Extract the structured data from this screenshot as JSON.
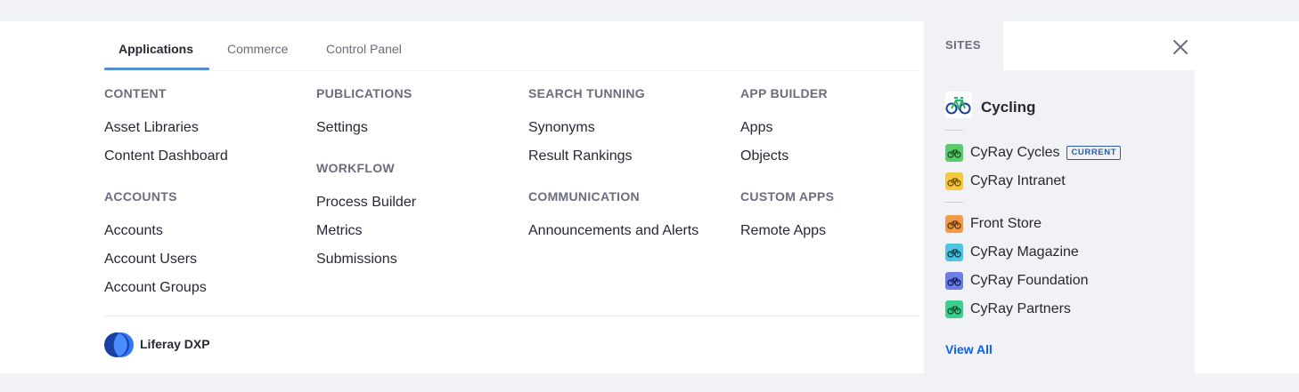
{
  "tabs": [
    {
      "label": "Applications",
      "active": true
    },
    {
      "label": "Commerce",
      "active": false
    },
    {
      "label": "Control Panel",
      "active": false
    }
  ],
  "columns": [
    {
      "sections": [
        {
          "title": "CONTENT",
          "items": [
            "Asset Libraries",
            "Content Dashboard"
          ]
        },
        {
          "title": "ACCOUNTS",
          "items": [
            "Accounts",
            "Account Users",
            "Account Groups"
          ]
        }
      ]
    },
    {
      "sections": [
        {
          "title": "PUBLICATIONS",
          "items": [
            "Settings"
          ]
        },
        {
          "title": "WORKFLOW",
          "items": [
            "Process Builder",
            "Metrics",
            "Submissions"
          ]
        }
      ]
    },
    {
      "sections": [
        {
          "title": "SEARCH TUNNING",
          "items": [
            "Synonyms",
            "Result Rankings"
          ]
        },
        {
          "title": "COMMUNICATION",
          "items": [
            "Announcements and Alerts"
          ]
        }
      ]
    },
    {
      "sections": [
        {
          "title": "APP BUILDER",
          "items": [
            "Apps",
            "Objects"
          ]
        },
        {
          "title": "CUSTOM APPS",
          "items": [
            "Remote Apps"
          ]
        }
      ]
    }
  ],
  "footer": {
    "logo_text": "Liferay DXP",
    "logo_icon": "liferay-logo-icon"
  },
  "sites": {
    "tab_label": "SITES",
    "close_icon": "close-icon",
    "current_site": "Cycling",
    "recent": [
      {
        "label": "CyRay Cycles",
        "badge": "CURRENT",
        "color": "#5acb6e"
      },
      {
        "label": "CyRay Intranet",
        "badge": "",
        "color": "#f5c842"
      }
    ],
    "others": [
      {
        "label": "Front Store",
        "color": "#f2994a"
      },
      {
        "label": "CyRay Magazine",
        "color": "#4fc3e0"
      },
      {
        "label": "CyRay Foundation",
        "color": "#6d7fe6"
      },
      {
        "label": "CyRay Partners",
        "color": "#3ecf8e"
      }
    ],
    "view_all": "View All"
  },
  "colors": {
    "accent": "#528ed4",
    "link": "#0b5fff",
    "badge": "#2e5aac"
  }
}
